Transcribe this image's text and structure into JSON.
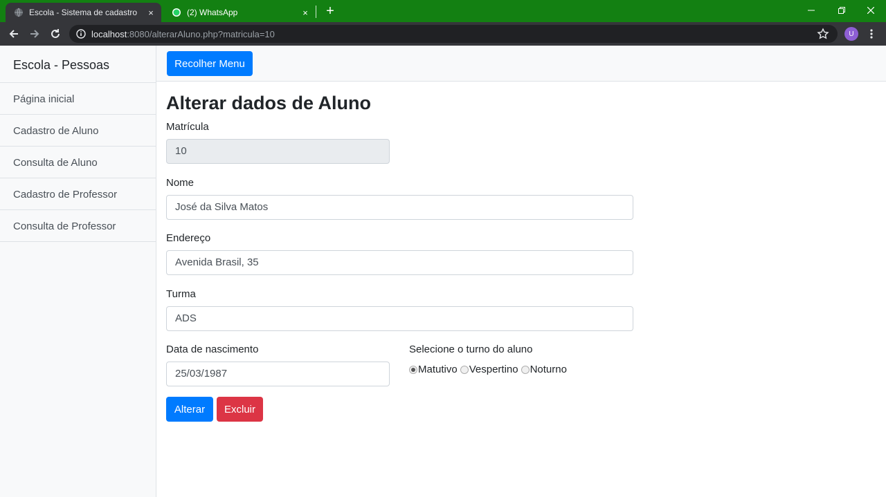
{
  "browser": {
    "tabs": [
      {
        "title": "Escola - Sistema de cadastro",
        "close": "×"
      },
      {
        "title": "(2) WhatsApp",
        "close": "×"
      }
    ],
    "new_tab": "+",
    "url_host": "localhost",
    "url_rest": ":8080/alterarAluno.php?matricula=10",
    "profile_initial": "U",
    "accent_color": "#138012"
  },
  "sidebar": {
    "heading": "Escola - Pessoas",
    "items": [
      {
        "label": "Página inicial"
      },
      {
        "label": "Cadastro de Aluno"
      },
      {
        "label": "Consulta de Aluno"
      },
      {
        "label": "Cadastro de Professor"
      },
      {
        "label": "Consulta de Professor"
      }
    ]
  },
  "topnav": {
    "toggle_label": "Recolher Menu"
  },
  "form": {
    "title": "Alterar dados de Aluno",
    "matricula": {
      "label": "Matrícula",
      "value": "10"
    },
    "nome": {
      "label": "Nome",
      "value": "José da Silva Matos"
    },
    "endereco": {
      "label": "Endereço",
      "value": "Avenida Brasil, 35"
    },
    "turma": {
      "label": "Turma",
      "value": "ADS"
    },
    "nascimento": {
      "label": "Data de nascimento",
      "value": "25/03/1987"
    },
    "turno": {
      "label": "Selecione o turno do aluno",
      "options": [
        {
          "label": "Matutivo",
          "checked": true
        },
        {
          "label": "Vespertino",
          "checked": false
        },
        {
          "label": "Noturno",
          "checked": false
        }
      ]
    },
    "alterar_label": "Alterar",
    "excluir_label": "Excluir"
  }
}
